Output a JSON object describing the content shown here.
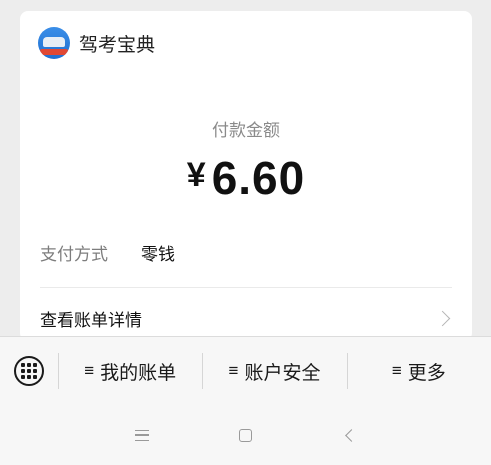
{
  "merchant": {
    "name": "驾考宝典",
    "logo_icon": "car-app-logo-icon"
  },
  "payment": {
    "amount_label": "付款金额",
    "currency_symbol": "¥",
    "amount": "6.60",
    "method_label": "支付方式",
    "method_value": "零钱",
    "detail_link": "查看账单详情"
  },
  "menu": {
    "keyboard_icon": "keyboard-icon",
    "items": [
      {
        "icon": "≡",
        "label": "我的账单"
      },
      {
        "icon": "≡",
        "label": "账户安全"
      },
      {
        "icon": "≡",
        "label": "更多"
      }
    ]
  },
  "navbar": {
    "icons": [
      "menu-icon",
      "home-icon",
      "back-icon"
    ]
  },
  "colors": {
    "background": "#ededed",
    "card": "#ffffff",
    "label_gray": "#8a8a8a",
    "text": "#111111"
  }
}
